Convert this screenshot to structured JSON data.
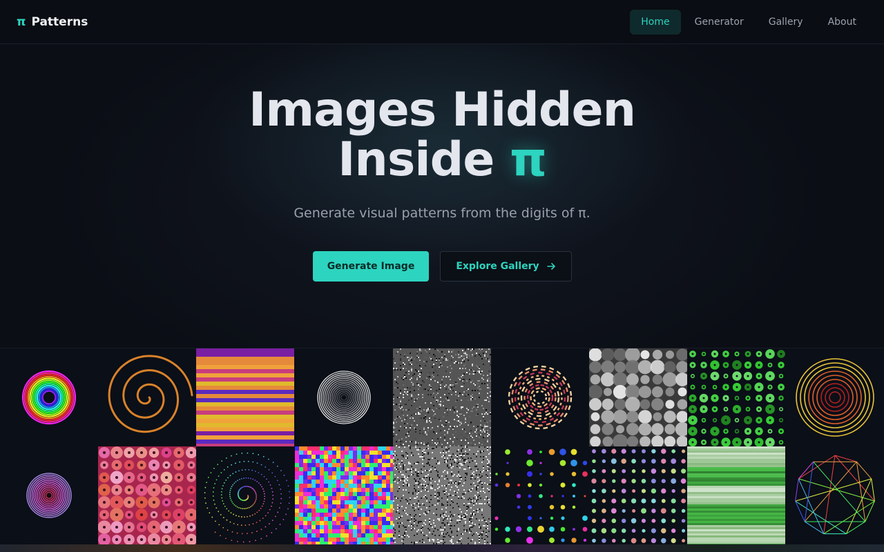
{
  "brand": {
    "symbol": "π",
    "name": "Patterns"
  },
  "nav": {
    "items": [
      {
        "label": "Home",
        "active": true
      },
      {
        "label": "Generator",
        "active": false
      },
      {
        "label": "Gallery",
        "active": false
      },
      {
        "label": "About",
        "active": false
      }
    ]
  },
  "hero": {
    "title_line1": "Images Hidden",
    "title_line2_prefix": "Inside",
    "title_symbol": "π",
    "subtitle": "Generate visual patterns from the digits of π.",
    "primary_button": "Generate Image",
    "secondary_button": "Explore Gallery"
  },
  "colors": {
    "accent": "#2dd4bf",
    "background": "#0b0e15",
    "accent_tint": "#0f2a2c"
  },
  "gallery": {
    "tiles": [
      {
        "pattern": "rainbow-rings",
        "icon": "rainbow-rings-icon"
      },
      {
        "pattern": "orange-spiral",
        "icon": "spiral-icon"
      },
      {
        "pattern": "horizontal-stripes",
        "icon": "stripes-icon"
      },
      {
        "pattern": "white-rings",
        "icon": "concentric-rings-icon"
      },
      {
        "pattern": "gray-noise",
        "icon": "noise-icon"
      },
      {
        "pattern": "dashed-rings",
        "icon": "dashed-rings-icon"
      },
      {
        "pattern": "gray-blur-grid",
        "icon": "blur-grid-icon"
      },
      {
        "pattern": "green-dot-grid",
        "icon": "dot-grid-icon"
      },
      {
        "pattern": "gold-red-rings",
        "icon": "rings-icon"
      },
      {
        "pattern": "lavender-disc",
        "icon": "disc-icon"
      },
      {
        "pattern": "pink-blob-grid",
        "icon": "blob-grid-icon"
      },
      {
        "pattern": "dotted-spiral",
        "icon": "dotted-spiral-icon"
      },
      {
        "pattern": "color-pixels",
        "icon": "pixel-grid-icon"
      },
      {
        "pattern": "bw-noise",
        "icon": "noise-icon"
      },
      {
        "pattern": "color-dots-dark",
        "icon": "dots-icon"
      },
      {
        "pattern": "pastel-dot-grid",
        "icon": "dot-grid-icon"
      },
      {
        "pattern": "green-bands",
        "icon": "bands-icon"
      },
      {
        "pattern": "rainbow-polygon",
        "icon": "polygon-icon"
      }
    ]
  }
}
